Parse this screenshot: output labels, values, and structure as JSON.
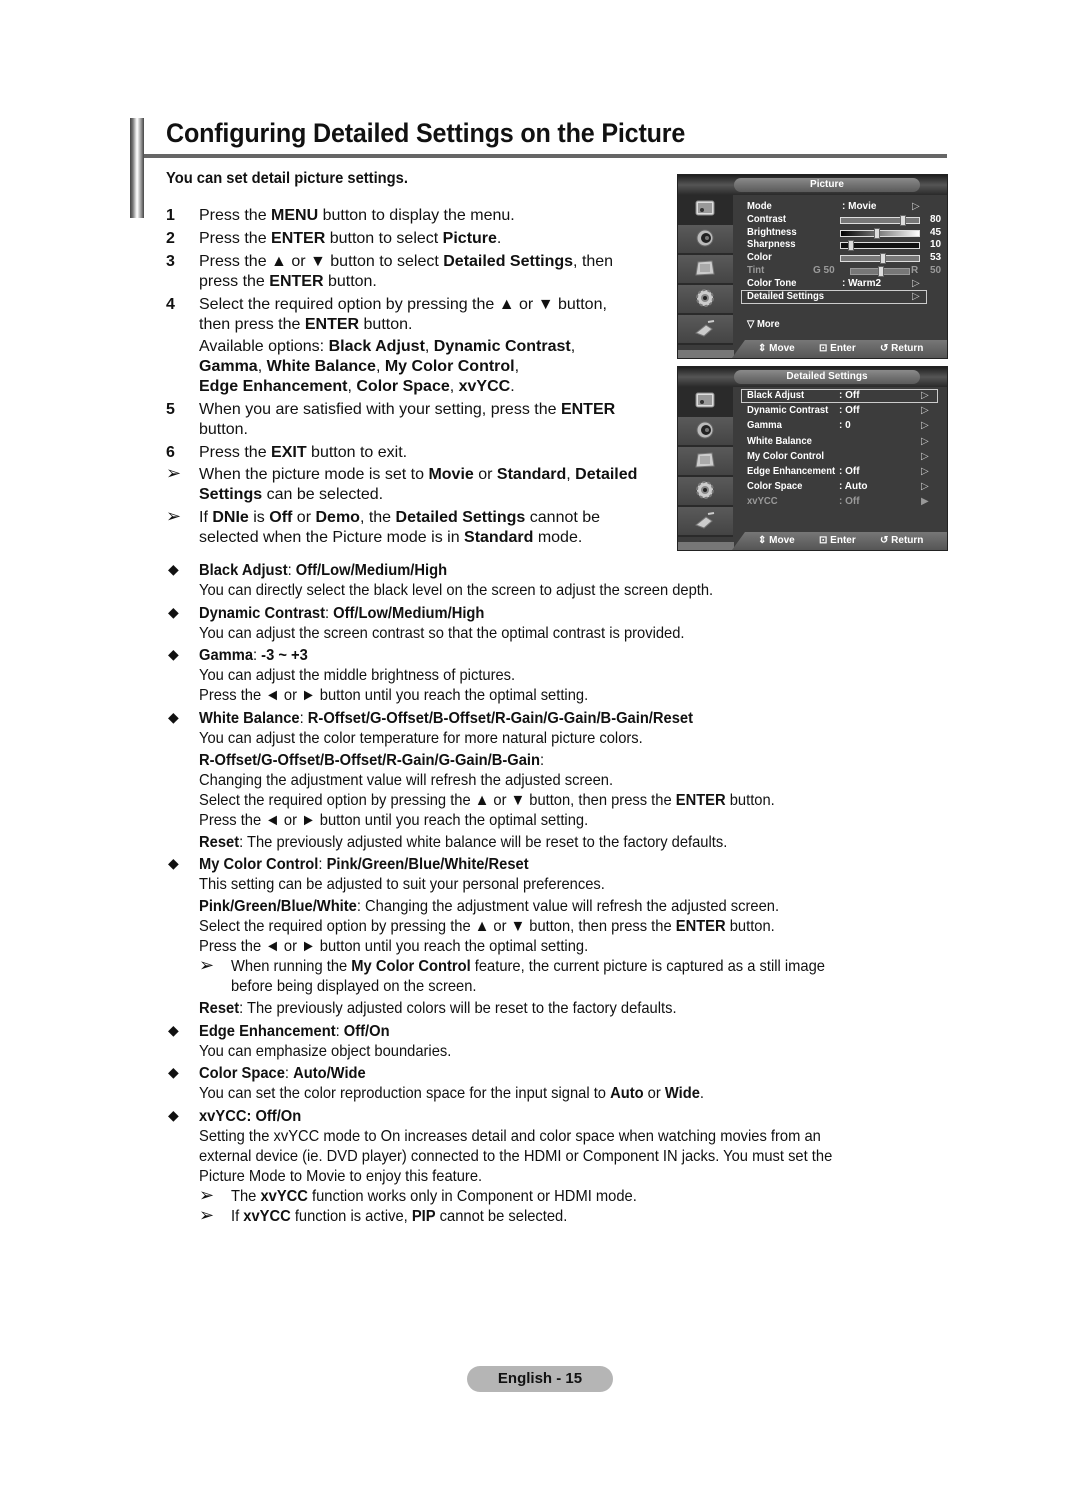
{
  "title": "Configuring Detailed Settings on the Picture",
  "subtitle": "You can set detail picture settings.",
  "steps": [
    {
      "num": "1",
      "lines": [
        "Press the <b>MENU</b> button to display the menu."
      ]
    },
    {
      "num": "2",
      "lines": [
        "Press the <b>ENTER</b> button to select <b>Picture</b>."
      ]
    },
    {
      "num": "3",
      "lines": [
        "Press the ▲ or ▼ button to select <b>Detailed Settings</b>, then",
        "press the <b>ENTER</b> button."
      ]
    },
    {
      "num": "4",
      "lines": [
        "Select the required option by pressing the ▲ or ▼ button,",
        "then press the <b>ENTER</b> button."
      ]
    },
    {
      "num": "",
      "lines": [
        "Available options: <b>Black Adjust</b>, <b>Dynamic Contrast</b>,",
        "<b>Gamma</b>, <b>White Balance</b>, <b>My Color Control</b>,",
        "<b>Edge Enhancement</b>, <b>Color Space</b>, <b>xvYCC</b>."
      ]
    },
    {
      "num": "5",
      "lines": [
        "When you are satisfied with your setting, press the <b>ENTER</b>",
        "button."
      ]
    },
    {
      "num": "6",
      "lines": [
        "Press the <b>EXIT</b> button to exit."
      ]
    }
  ],
  "notes_top": [
    {
      "lines": [
        "When the picture mode is set to <b>Movie</b> or <b>Standard</b>, <b>Detailed</b>",
        "<b>Settings</b> can be selected."
      ]
    },
    {
      "lines": [
        "If <b>DNIe</b> is <b>Off</b> or <b>Demo</b>, the <b>Detailed Settings</b> cannot be",
        "selected when the Picture mode is in <b>Standard</b> mode."
      ]
    }
  ],
  "osd_picture": {
    "tab": "Picture",
    "rows": [
      {
        "label": "Mode",
        "value": ": Movie",
        "arrow": "▷"
      },
      {
        "label": "Contrast",
        "slider": 80,
        "number": "80"
      },
      {
        "label": "Brightness",
        "slider": 45,
        "number": "45"
      },
      {
        "label": "Sharpness",
        "slider": 10,
        "number": "10"
      },
      {
        "label": "Color",
        "slider": 53,
        "number": "53"
      },
      {
        "label": "Tint",
        "left": "G  50",
        "right": "R",
        "slider": 50,
        "number": "50",
        "dim": true
      },
      {
        "label": "Color Tone",
        "value": ": Warm2",
        "arrow": "▷"
      },
      {
        "label": "Detailed Settings",
        "arrow": "▷",
        "selected": true
      }
    ],
    "more": "▽ More",
    "footer": {
      "move": "Move",
      "enter": "Enter",
      "return": "Return"
    }
  },
  "osd_detailed": {
    "tab": "Detailed Settings",
    "rows": [
      {
        "label": "Black Adjust",
        "value": ": Off",
        "arrow": "▷",
        "selected": true
      },
      {
        "label": "Dynamic Contrast",
        "value": ": Off",
        "arrow": "▷"
      },
      {
        "label": "Gamma",
        "value": ": 0",
        "arrow": "▷"
      },
      {
        "label": "White Balance",
        "value": "",
        "arrow": "▷"
      },
      {
        "label": "My Color Control",
        "value": "",
        "arrow": "▷"
      },
      {
        "label": "Edge Enhancement",
        "value": ": Off",
        "arrow": "▷"
      },
      {
        "label": "Color Space",
        "value": ": Auto",
        "arrow": "▷"
      },
      {
        "label": "xvYCC",
        "value": ": Off",
        "arrow": "▶",
        "dim": true
      }
    ],
    "footer": {
      "move": "Move",
      "enter": "Enter",
      "return": "Return"
    }
  },
  "options": [
    {
      "heading": "<b>Black Adjust</b>: <b>Off/Low/Medium/High</b>",
      "body": [
        {
          "t": "You can directly select the black level on the screen to adjust the screen depth."
        }
      ]
    },
    {
      "heading": "<b>Dynamic Contrast</b>: <b>Off/Low/Medium/High</b>",
      "body": [
        {
          "t": "You can adjust the screen contrast so that the optimal contrast is provided."
        }
      ]
    },
    {
      "heading": "<b>Gamma</b>: <b>-3 ~ +3</b>",
      "body": [
        {
          "t": "You can adjust the middle brightness of pictures."
        },
        {
          "t": "Press the ◄ or ► button until you reach the optimal setting."
        }
      ]
    },
    {
      "heading": "<b>White Balance</b>: <b>R-Offset/G-Offset/B-Offset/R-Gain/G-Gain/B-Gain/Reset</b>",
      "body": [
        {
          "t": "You can adjust the color temperature for more natural picture colors."
        },
        {
          "t": "<b>R-Offset/G-Offset/B-Offset/R-Gain/G-Gain/B-Gain</b>:",
          "gap": true
        },
        {
          "t": "Changing the adjustment value will refresh the adjusted screen."
        },
        {
          "t": "Select the required option by pressing the ▲ or ▼ button, then press the <b>ENTER</b> button."
        },
        {
          "t": "Press the ◄ or ► button until you reach the optimal setting."
        },
        {
          "t": "<b>Reset</b>: The previously adjusted white balance will be reset to the factory defaults.",
          "gap": true
        }
      ]
    },
    {
      "heading": "<b>My Color Control</b>: <b>Pink/Green/Blue/White/Reset</b>",
      "body": [
        {
          "t": "This setting can be adjusted to suit your personal preferences."
        },
        {
          "t": "<b>Pink/Green/Blue/White</b>: Changing the adjustment value will refresh the adjusted screen.",
          "gap": true
        },
        {
          "t": "Select the required option by pressing the ▲ or ▼ button, then press the <b>ENTER</b> button."
        },
        {
          "t": "Press the ◄ or ► button until you reach the optimal setting."
        },
        {
          "t": "When running the <b>My Color Control</b> feature, the current picture is captured as a still image",
          "note": true
        },
        {
          "t": "before being displayed on the screen.",
          "indent": true
        },
        {
          "t": "<b>Reset</b>: The previously adjusted colors will be reset to the factory defaults.",
          "gap": true
        }
      ]
    },
    {
      "heading": "<b>Edge Enhancement</b>: <b>Off/On</b>",
      "body": [
        {
          "t": "You can emphasize object boundaries."
        }
      ]
    },
    {
      "heading": "<b>Color Space</b>: <b>Auto/Wide</b>",
      "body": [
        {
          "t": "You can set the color reproduction space for the input signal to <b>Auto</b> or <b>Wide</b>."
        }
      ]
    },
    {
      "heading": "<b>xvYCC: Off/On</b>",
      "body": [
        {
          "t": "Setting the xvYCC mode to On increases detail and color space when watching movies from an"
        },
        {
          "t": "external device (ie. DVD player) connected to the HDMI or Component IN jacks. You must set the"
        },
        {
          "t": "Picture Mode to Movie to enjoy this feature."
        },
        {
          "t": "The <b>xvYCC</b> function works only in Component or HDMI mode.",
          "note": true
        },
        {
          "t": "If <b>xvYCC</b> function is active, <b>PIP</b> cannot be selected.",
          "note": true
        }
      ]
    }
  ],
  "icons": {
    "note": "➢",
    "bullet": "◆"
  },
  "page_label": "English - 15"
}
